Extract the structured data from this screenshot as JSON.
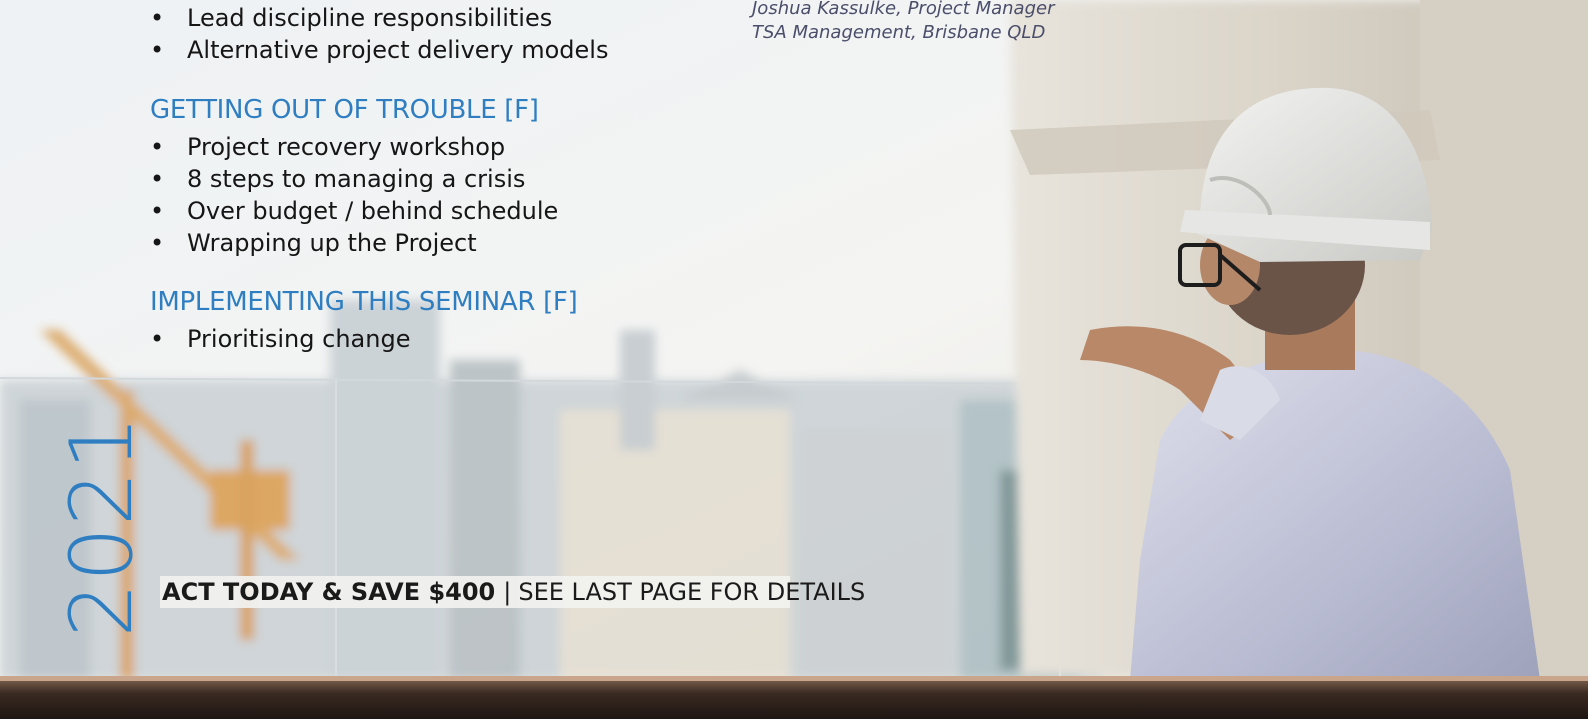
{
  "section1": {
    "items": [
      "Lead discipline responsibilities",
      "Alternative project delivery models"
    ]
  },
  "section2": {
    "heading": "GETTING OUT OF TROUBLE  [F]",
    "items": [
      "Project recovery workshop",
      "8 steps to managing a crisis",
      "Over budget / behind schedule",
      "Wrapping up the Project"
    ]
  },
  "section3": {
    "heading": "IMPLEMENTING THIS SEMINAR  [F]",
    "items": [
      "Prioritising change"
    ]
  },
  "testimonial": {
    "author": "Joshua Kassulke, Project Manager",
    "org": "TSA Management, Brisbane  QLD"
  },
  "year": "2021",
  "cta": {
    "bold": "ACT TODAY & SAVE $400",
    "separator": "|",
    "rest": "SEE LAST PAGE FOR DETAILS"
  },
  "colors": {
    "accent": "#2e7ec1",
    "text": "#161616",
    "quote": "#4a4e6a"
  }
}
